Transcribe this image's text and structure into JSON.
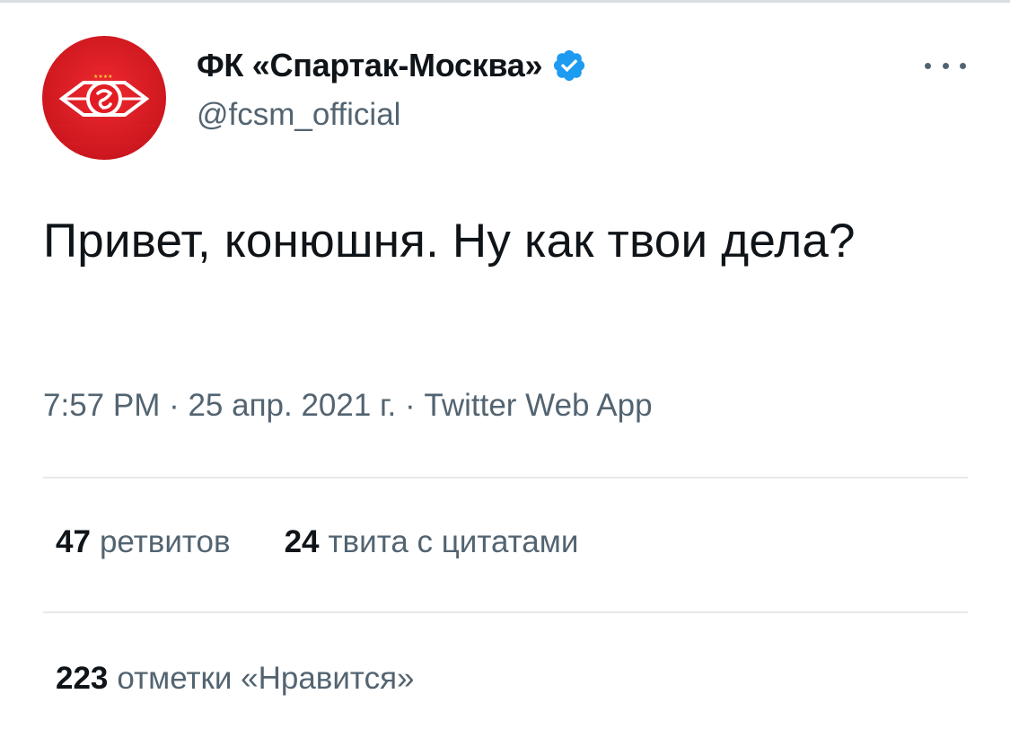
{
  "author": {
    "display_name": "ФК «Спартак-Москва»",
    "handle": "@fcsm_official",
    "verified": true,
    "avatar_icon": "spartak-logo-icon",
    "avatar_color": "#e31b23"
  },
  "menu": {
    "icon": "more-dots-icon"
  },
  "tweet": {
    "text": "Привет, конюшня. Ну как твои дела?",
    "time": "7:57 PM",
    "separator_1": " · ",
    "date": "25 апр. 2021 г.",
    "separator_2": " · ",
    "source": "Twitter Web App"
  },
  "stats": {
    "retweets_count": "47",
    "retweets_label": "ретвитов",
    "quotes_count": "24",
    "quotes_label": "твита с цитатами",
    "likes_count": "223",
    "likes_label": "отметки «Нравится»"
  },
  "colors": {
    "text_primary": "#0f1419",
    "text_secondary": "#536471",
    "verified_blue": "#1d9bf0",
    "divider": "#e6e9ec"
  }
}
